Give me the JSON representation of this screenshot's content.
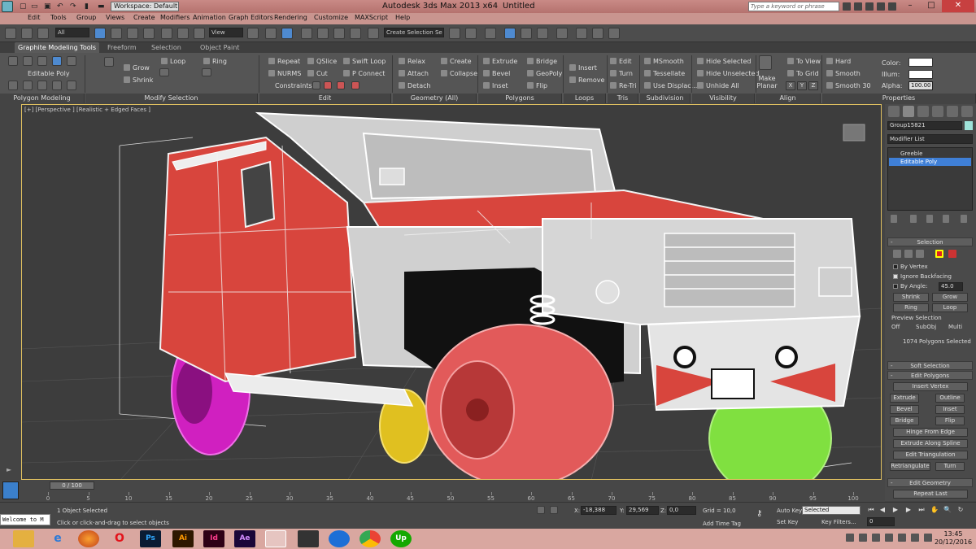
{
  "titlebar": {
    "workspace": "Workspace: Default",
    "app_title": "Autodesk 3ds Max  2013 x64",
    "file_title": "Untitled",
    "search_placeholder": "Type a keyword or phrase",
    "minimize": "–",
    "maximize": "□",
    "close": "✕"
  },
  "menu": [
    "Edit",
    "Tools",
    "Group",
    "Views",
    "Create",
    "Modifiers",
    "Animation",
    "Graph Editors",
    "Rendering",
    "Customize",
    "MAXScript",
    "Help"
  ],
  "maintoolbar": {
    "filter": "All",
    "refcoord": "View",
    "selection_set": "Create Selection Se"
  },
  "ribbon": {
    "tabs": [
      "Graphite Modeling Tools",
      "Freeform",
      "Selection",
      "Object Paint"
    ],
    "polygon_modeling": {
      "mode": "Editable Poly",
      "group": "Polygon Modeling"
    },
    "modify_selection": {
      "items": [
        "Grow",
        "Shrink",
        "Loop",
        "Ring"
      ],
      "group": "Modify Selection"
    },
    "edit": {
      "items": [
        "Repeat",
        "QSlice",
        "Swift Loop",
        "NURMS",
        "Cut",
        "P Connect"
      ],
      "constraints": "Constraints:",
      "group": "Edit"
    },
    "geometry": {
      "items": [
        "Relax",
        "Create",
        "Attach",
        "Collapse",
        "Detach"
      ],
      "group": "Geometry (All)"
    },
    "polygons": {
      "items": [
        "Extrude",
        "Bridge",
        "Bevel",
        "GeoPoly",
        "Inset",
        "Flip"
      ],
      "group": "Polygons"
    },
    "loops": {
      "items": [
        "Insert",
        "Remove"
      ],
      "group": "Loops"
    },
    "tris": {
      "items": [
        "Edit",
        "Turn",
        "Re-Tri"
      ],
      "group": "Tris"
    },
    "subdivision": {
      "items": [
        "MSmooth",
        "Tessellate",
        "Use Displac..."
      ],
      "group": "Subdivision"
    },
    "visibility": {
      "items": [
        "Hide Selected",
        "Hide Unselected",
        "Unhide All"
      ],
      "group": "Visibility"
    },
    "align": {
      "make_planar": "Make Planar",
      "items": [
        "To View",
        "To Grid"
      ],
      "axes": [
        "X",
        "Y",
        "Z"
      ],
      "group": "Align"
    },
    "properties": {
      "items": [
        "Hard",
        "Smooth",
        "Smooth 30"
      ],
      "color": "Color:",
      "illum": "Illum:",
      "alpha": "Alpha:",
      "alpha_value": "100.00",
      "group": "Properties"
    }
  },
  "viewport": {
    "label": "[+] [Perspective ] [Realistic + Edged Faces ]",
    "colors": {
      "body_red": "#d8453d",
      "wire_white": "#f2f2f2",
      "wheel_magenta": "#d020c0",
      "wheel_green": "#80e040",
      "wheel_yellow": "#e0c020",
      "wheel_red": "#e25a5a",
      "bg": "#3d3d3d",
      "grid": "#5a5a5a"
    }
  },
  "command_panel": {
    "object_name": "Group15821",
    "modifier_list": "Modifier List",
    "stack": [
      "Greeble",
      "Editable Poly"
    ],
    "selection": {
      "title": "Selection",
      "by_vertex": "By Vertex",
      "ignore_backfacing": "Ignore Backfacing",
      "by_angle": "By Angle:",
      "angle_value": "45.0",
      "shrink": "Shrink",
      "grow": "Grow",
      "ring": "Ring",
      "loop": "Loop",
      "preview": "Preview Selection",
      "preview_options": [
        "Off",
        "SubObj",
        "Multi"
      ],
      "status": "1074 Polygons Selected"
    },
    "soft_selection": "Soft Selection",
    "edit_polygons": {
      "title": "Edit Polygons",
      "insert_vertex": "Insert Vertex",
      "extrude": "Extrude",
      "outline": "Outline",
      "bevel": "Bevel",
      "inset": "Inset",
      "bridge": "Bridge",
      "flip": "Flip",
      "hinge": "Hinge From Edge",
      "extrude_spline": "Extrude Along Spline",
      "edit_triangulation": "Edit Triangulation",
      "retriangulate": "Retriangulate",
      "turn": "Turn"
    },
    "edit_geometry": {
      "title": "Edit Geometry",
      "repeat_last": "Repeat Last"
    }
  },
  "timeline": {
    "slider": "0 / 100",
    "ticks": [
      "0",
      "5",
      "10",
      "15",
      "20",
      "25",
      "30",
      "35",
      "40",
      "45",
      "50",
      "55",
      "60",
      "65",
      "70",
      "75",
      "80",
      "85",
      "90",
      "95",
      "100"
    ]
  },
  "statusbar": {
    "objects_selected": "1 Object Selected",
    "prompt": "Click or click-and-drag to select objects",
    "maxscript": "Welcome to M",
    "x_label": "X:",
    "x_value": "-18,388",
    "y_label": "Y:",
    "y_value": "29,569",
    "z_label": "Z:",
    "z_value": "0,0",
    "grid": "Grid = 10,0",
    "add_time_tag": "Add Time Tag",
    "auto_key": "Auto Key",
    "set_key": "Set Key",
    "key_mode": "Selected",
    "key_filters": "Key Filters...",
    "frame": "0"
  },
  "taskbar": {
    "apps": [
      {
        "name": "explorer",
        "label": ""
      },
      {
        "name": "ie",
        "label": "e"
      },
      {
        "name": "firefox",
        "label": ""
      },
      {
        "name": "opera",
        "label": "O"
      },
      {
        "name": "photoshop",
        "label": "Ps"
      },
      {
        "name": "illustrator",
        "label": "Ai"
      },
      {
        "name": "indesign",
        "label": "Id"
      },
      {
        "name": "aftereffects",
        "label": "Ae"
      },
      {
        "name": "3dsmax",
        "label": ""
      },
      {
        "name": "zbrush",
        "label": ""
      },
      {
        "name": "teamviewer",
        "label": ""
      },
      {
        "name": "chrome",
        "label": ""
      },
      {
        "name": "upwork",
        "label": "Up"
      }
    ],
    "time": "13:45",
    "date": "20/12/2016"
  }
}
